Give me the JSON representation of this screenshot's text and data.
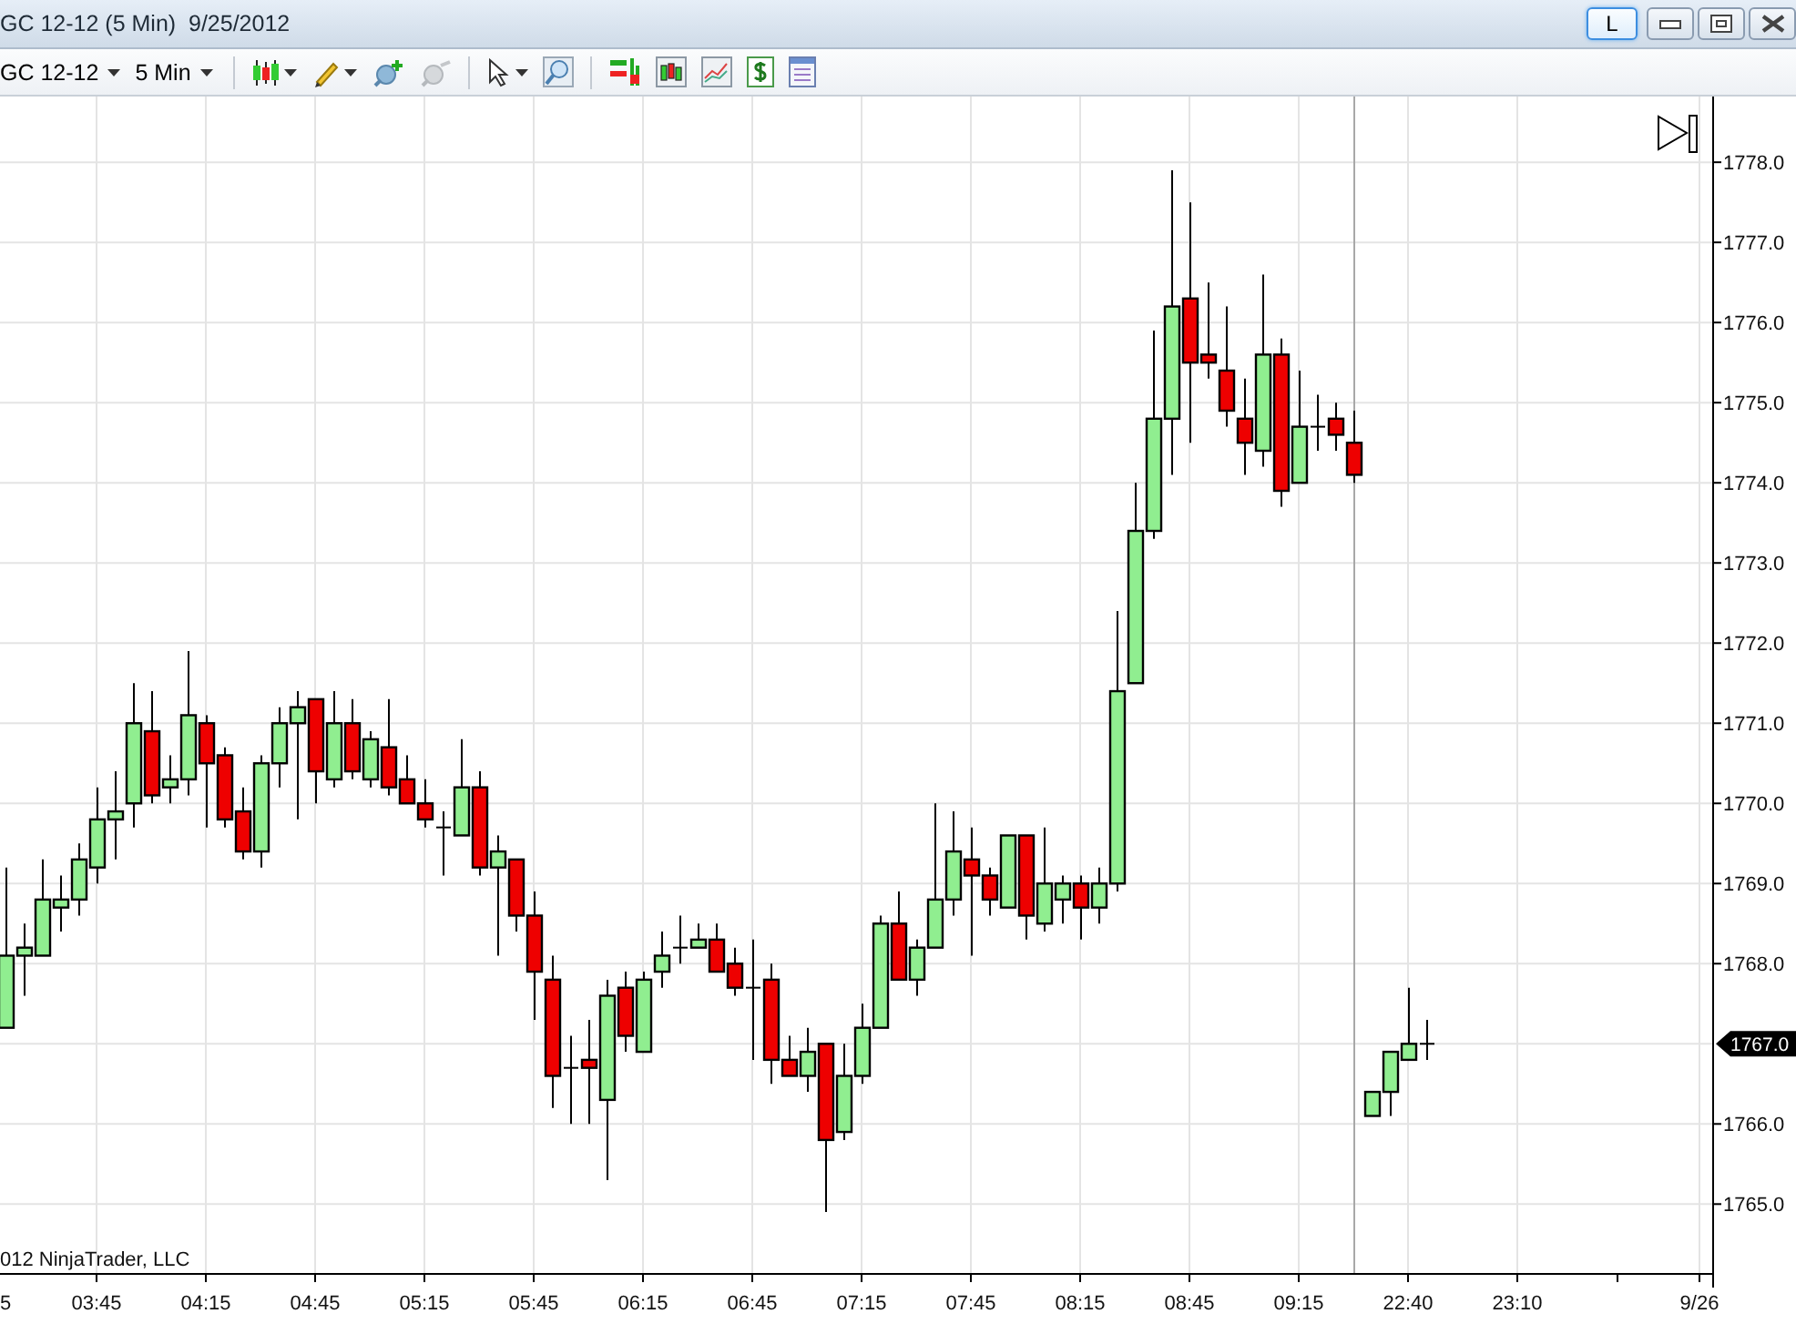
{
  "window": {
    "title": "GC 12-12 (5 Min)  9/25/2012",
    "link_button": "L"
  },
  "toolbar": {
    "instrument": "GC 12-12",
    "interval": "5 Min"
  },
  "chart": {
    "copyright": "012 NinjaTrader, LLC",
    "last_price": "1767.0",
    "price_labels": [
      "1778.0",
      "1777.0",
      "1776.0",
      "1775.0",
      "1774.0",
      "1773.0",
      "1772.0",
      "1771.0",
      "1770.0",
      "1769.0",
      "1768.0",
      "1766.0",
      "1765.0"
    ],
    "time_labels": [
      "5",
      "03:45",
      "04:15",
      "04:45",
      "05:15",
      "05:45",
      "06:15",
      "06:45",
      "07:15",
      "07:45",
      "08:15",
      "08:45",
      "09:15",
      "22:40",
      "23:10",
      "9/26"
    ]
  }
}
